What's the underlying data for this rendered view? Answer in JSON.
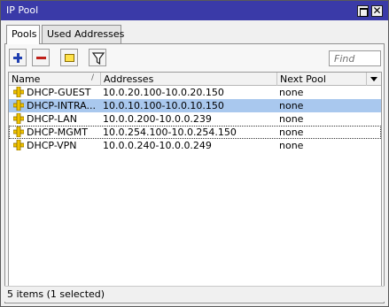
{
  "window": {
    "title": "IP Pool"
  },
  "tabs": [
    {
      "label": "Pools",
      "active": true
    },
    {
      "label": "Used Addresses",
      "active": false
    }
  ],
  "toolbar": {
    "icons": [
      "add-icon",
      "remove-icon",
      "comment-icon",
      "filter-icon"
    ],
    "find_placeholder": "Find"
  },
  "table": {
    "columns": [
      "Name",
      "Addresses",
      "Next Pool"
    ],
    "sort_indicator": "/",
    "rows": [
      {
        "name": "DHCP-GUEST",
        "addresses": "10.0.20.100-10.0.20.150",
        "next_pool": "none",
        "selected": false
      },
      {
        "name": "DHCP-INTRA...",
        "addresses": "10.0.10.100-10.0.10.150",
        "next_pool": "none",
        "selected": true
      },
      {
        "name": "DHCP-LAN",
        "addresses": "10.0.0.200-10.0.0.239",
        "next_pool": "none",
        "selected": false
      },
      {
        "name": "DHCP-MGMT",
        "addresses": "10.0.254.100-10.0.254.150",
        "next_pool": "none",
        "selected": false
      },
      {
        "name": "DHCP-VPN",
        "addresses": "10.0.0.240-10.0.0.249",
        "next_pool": "none",
        "selected": false
      }
    ]
  },
  "status": {
    "text": "5 items (1 selected)"
  },
  "colors": {
    "titlebar": "#3a3aa8",
    "selection": "#a9c8ee",
    "add": "#1f3fb0",
    "remove": "#c0201a"
  }
}
